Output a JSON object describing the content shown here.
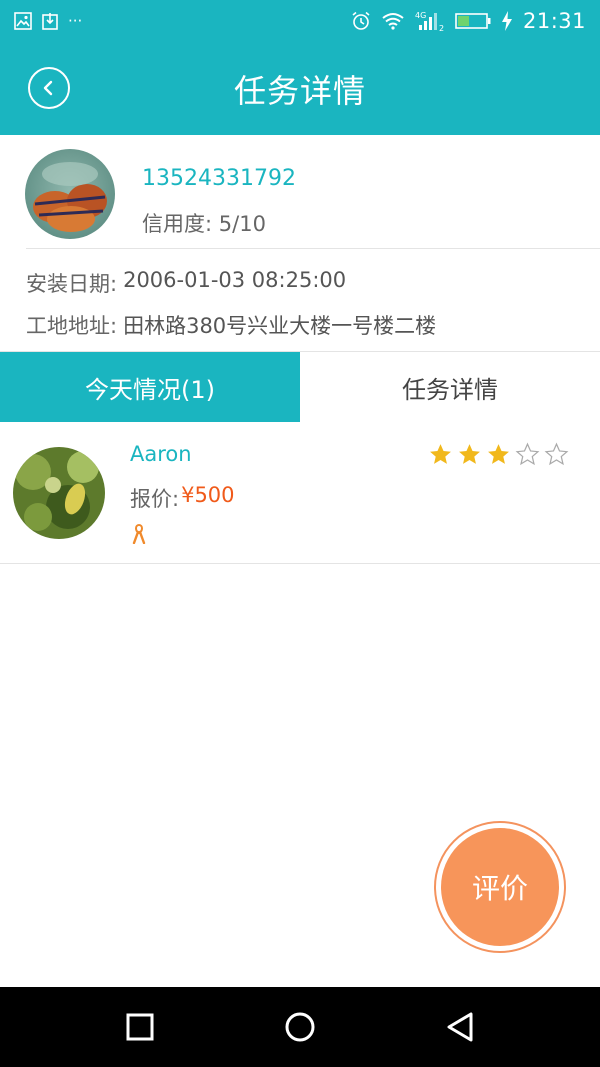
{
  "status_bar": {
    "time": "21:31",
    "icons_left": [
      "image-icon",
      "download-icon",
      "more-icon"
    ],
    "more_text": "···",
    "network_label": "4G",
    "sim_index": "2",
    "icons_right": [
      "alarm-icon",
      "wifi-icon",
      "signal-icon",
      "battery-icon",
      "charging-icon"
    ]
  },
  "header": {
    "title": "任务详情"
  },
  "owner": {
    "phone": "13524331792",
    "credit_label": "信用度:",
    "credit_value": "5/10"
  },
  "info": {
    "install_date_label": "安装日期:",
    "install_date_value": "2006-01-03 08:25:00",
    "address_label": "工地地址:",
    "address_value": "田林路380号兴业大楼一号楼二楼"
  },
  "tabs": [
    {
      "label": "今天情况(1)",
      "active": true
    },
    {
      "label": "任务详情",
      "active": false
    }
  ],
  "bids": [
    {
      "name": "Aaron",
      "price_label": "报价:",
      "price": "¥500",
      "rating": 3,
      "rating_max": 5
    }
  ],
  "actions": {
    "rate_label": "评价"
  },
  "colors": {
    "primary": "#1ab5c0",
    "price": "#f05a1a",
    "star": "#f1b81c",
    "fab": "#f7955a"
  }
}
